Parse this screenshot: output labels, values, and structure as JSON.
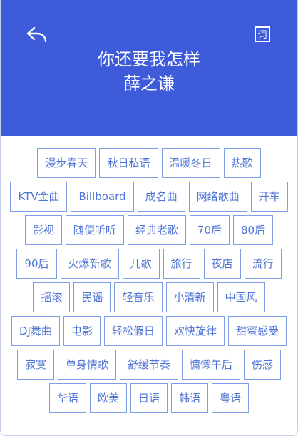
{
  "header": {
    "song_title": "你还要我怎样",
    "artist": "薛之谦",
    "lyric_button_glyph": "词",
    "background_color": "#3e5cd9"
  },
  "tag_rows": [
    [
      "漫步春天",
      "秋日私语",
      "温暖冬日",
      "热歌"
    ],
    [
      "KTV金曲",
      "Billboard",
      "成名曲",
      "网络歌曲",
      "开车"
    ],
    [
      "影视",
      "随便听听",
      "经典老歌",
      "70后",
      "80后"
    ],
    [
      "90后",
      "火爆新歌",
      "儿歌",
      "旅行",
      "夜店",
      "流行"
    ],
    [
      "摇滚",
      "民谣",
      "轻音乐",
      "小清新",
      "中国风"
    ],
    [
      "DJ舞曲",
      "电影",
      "轻松假日",
      "欢快旋律",
      "甜蜜感受"
    ],
    [
      "寂寞",
      "单身情歌",
      "舒缓节奏",
      "慵懒午后",
      "伤感"
    ],
    [
      "华语",
      "欧美",
      "日语",
      "韩语",
      "粤语"
    ]
  ],
  "colors": {
    "accent": "#3e5cd9",
    "tag_text": "#4f74d6",
    "tag_border": "#7f9ee6"
  }
}
